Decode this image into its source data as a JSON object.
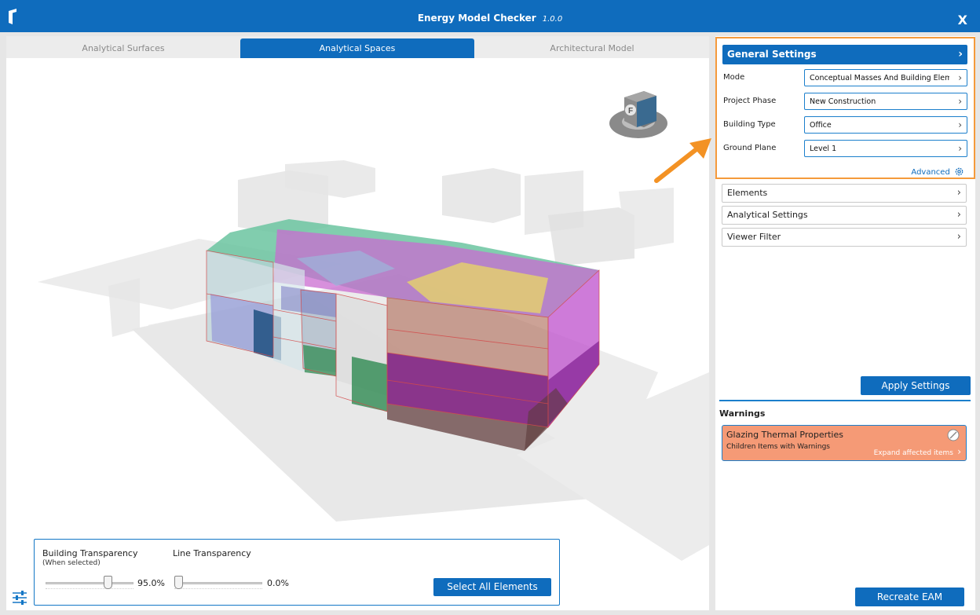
{
  "window": {
    "title": "Energy Model Checker",
    "version": "1.0.0",
    "close_label": "X"
  },
  "tabs": [
    {
      "label": "Analytical Surfaces",
      "active": false
    },
    {
      "label": "Analytical Spaces",
      "active": true
    },
    {
      "label": "Architectural Model",
      "active": false
    }
  ],
  "viewcube": {
    "face_label": "F"
  },
  "controls": {
    "building_transparency": {
      "label": "Building Transparency",
      "sublabel": "(When selected)",
      "value_text": "95.0%",
      "value": 0.95
    },
    "line_transparency": {
      "label": "Line Transparency",
      "value_text": "0.0%",
      "value": 0.0
    },
    "select_all_label": "Select All Elements"
  },
  "general_settings": {
    "header": "General Settings",
    "fields": [
      {
        "label": "Mode",
        "value": "Conceptual Masses And Building Elements"
      },
      {
        "label": "Project Phase",
        "value": "New Construction"
      },
      {
        "label": "Building Type",
        "value": "Office"
      },
      {
        "label": "Ground Plane",
        "value": "Level 1"
      }
    ],
    "advanced_label": "Advanced"
  },
  "sections": [
    {
      "label": "Elements"
    },
    {
      "label": "Analytical Settings"
    },
    {
      "label": "Viewer Filter"
    }
  ],
  "apply_label": "Apply Settings",
  "warnings": {
    "title": "Warnings",
    "items": [
      {
        "title": "Glazing Thermal Properties",
        "subtitle": "Children Items with Warnings",
        "expand_label": "Expand affected items"
      }
    ]
  },
  "recreate_label": "Recreate EAM",
  "colors": {
    "accent": "#0f6cbd",
    "highlight": "#f59a3b",
    "warning": "#f59a76"
  }
}
